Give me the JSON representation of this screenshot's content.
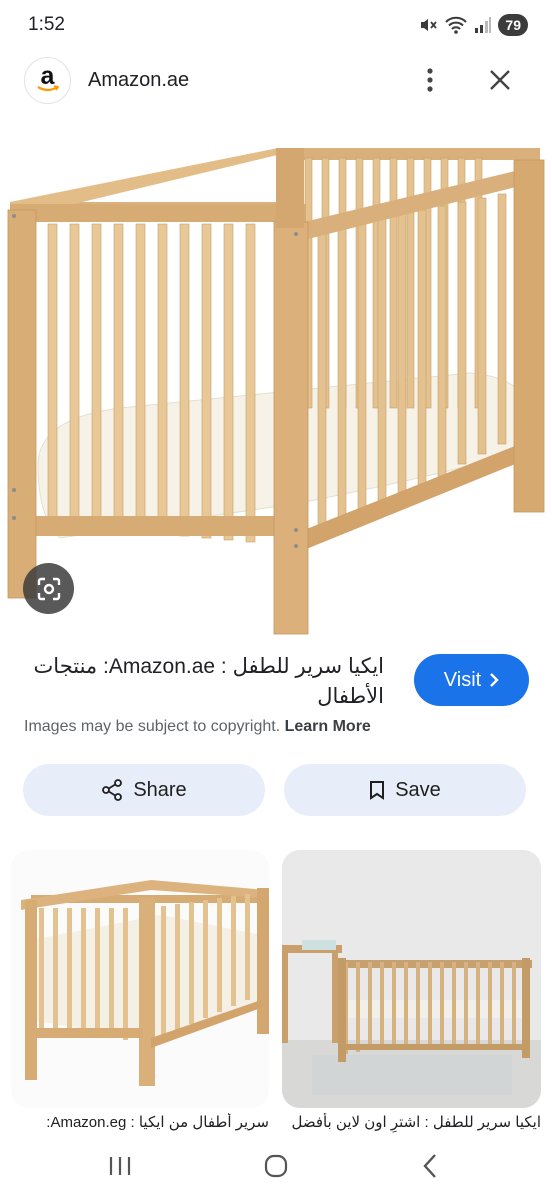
{
  "status_bar": {
    "time": "1:52",
    "battery": "79"
  },
  "header": {
    "site_name": "Amazon.ae",
    "logo_letter": "a"
  },
  "result": {
    "title": "ايكيا سرير للطفل : Amazon.ae: منتجات الأطفال",
    "visit_label": "Visit",
    "copyright_text": "Images may be subject to copyright.",
    "learn_more_label": "Learn More"
  },
  "actions": {
    "share_label": "Share",
    "save_label": "Save"
  },
  "related": [
    {
      "caption": "سرير أطفال من ايكيا : Amazon.eg:"
    },
    {
      "caption": "ايكيا سرير للطفل : اشترِ اون لاين بأفضل"
    }
  ],
  "colors": {
    "accent": "#1a73e8",
    "tonal_button": "#e8eef9",
    "wood": "#dcb37f"
  },
  "icons": [
    "mute-icon",
    "wifi-icon",
    "signal-icon",
    "more-vert-icon",
    "close-icon",
    "lens-icon",
    "chevron-right-icon",
    "share-icon",
    "bookmark-icon",
    "recents-icon",
    "home-icon",
    "back-icon"
  ]
}
